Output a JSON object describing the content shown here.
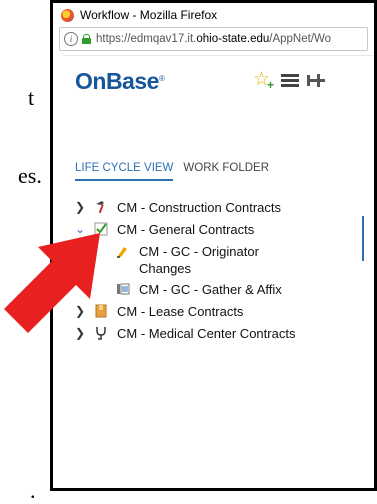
{
  "background": {
    "fragment_top": "t",
    "fragment_mid": "es.",
    "fragment_bottom": "."
  },
  "window": {
    "title": "Workflow - Mozilla Firefox",
    "url_prefix": "https://edmqav17.it.",
    "url_host": "ohio-state.edu",
    "url_path": "/AppNet/Wo"
  },
  "app": {
    "logo": "OnBase",
    "tabs": [
      {
        "label": "LIFE CYCLE VIEW",
        "active": true
      },
      {
        "label": "WORK FOLDER",
        "active": false
      }
    ],
    "tree": [
      {
        "label": "CM - Construction Contracts",
        "icon": "hammer-icon",
        "expanded": false
      },
      {
        "label": "CM - General Contracts",
        "icon": "checkbox-icon",
        "expanded": true
      },
      {
        "label": "CM - GC - Originator Changes",
        "icon": "highlighter-icon",
        "child": true
      },
      {
        "label": "CM - GC - Gather & Affix",
        "icon": "document-queue-icon",
        "child": true
      },
      {
        "label": "CM - Lease Contracts",
        "icon": "box-icon",
        "expanded": false
      },
      {
        "label": "CM - Medical Center Contracts",
        "icon": "medical-icon",
        "expanded": false
      }
    ]
  },
  "colors": {
    "accent": "#2c6fb5",
    "logo": "#17569b",
    "arrow": "#e8201f"
  }
}
